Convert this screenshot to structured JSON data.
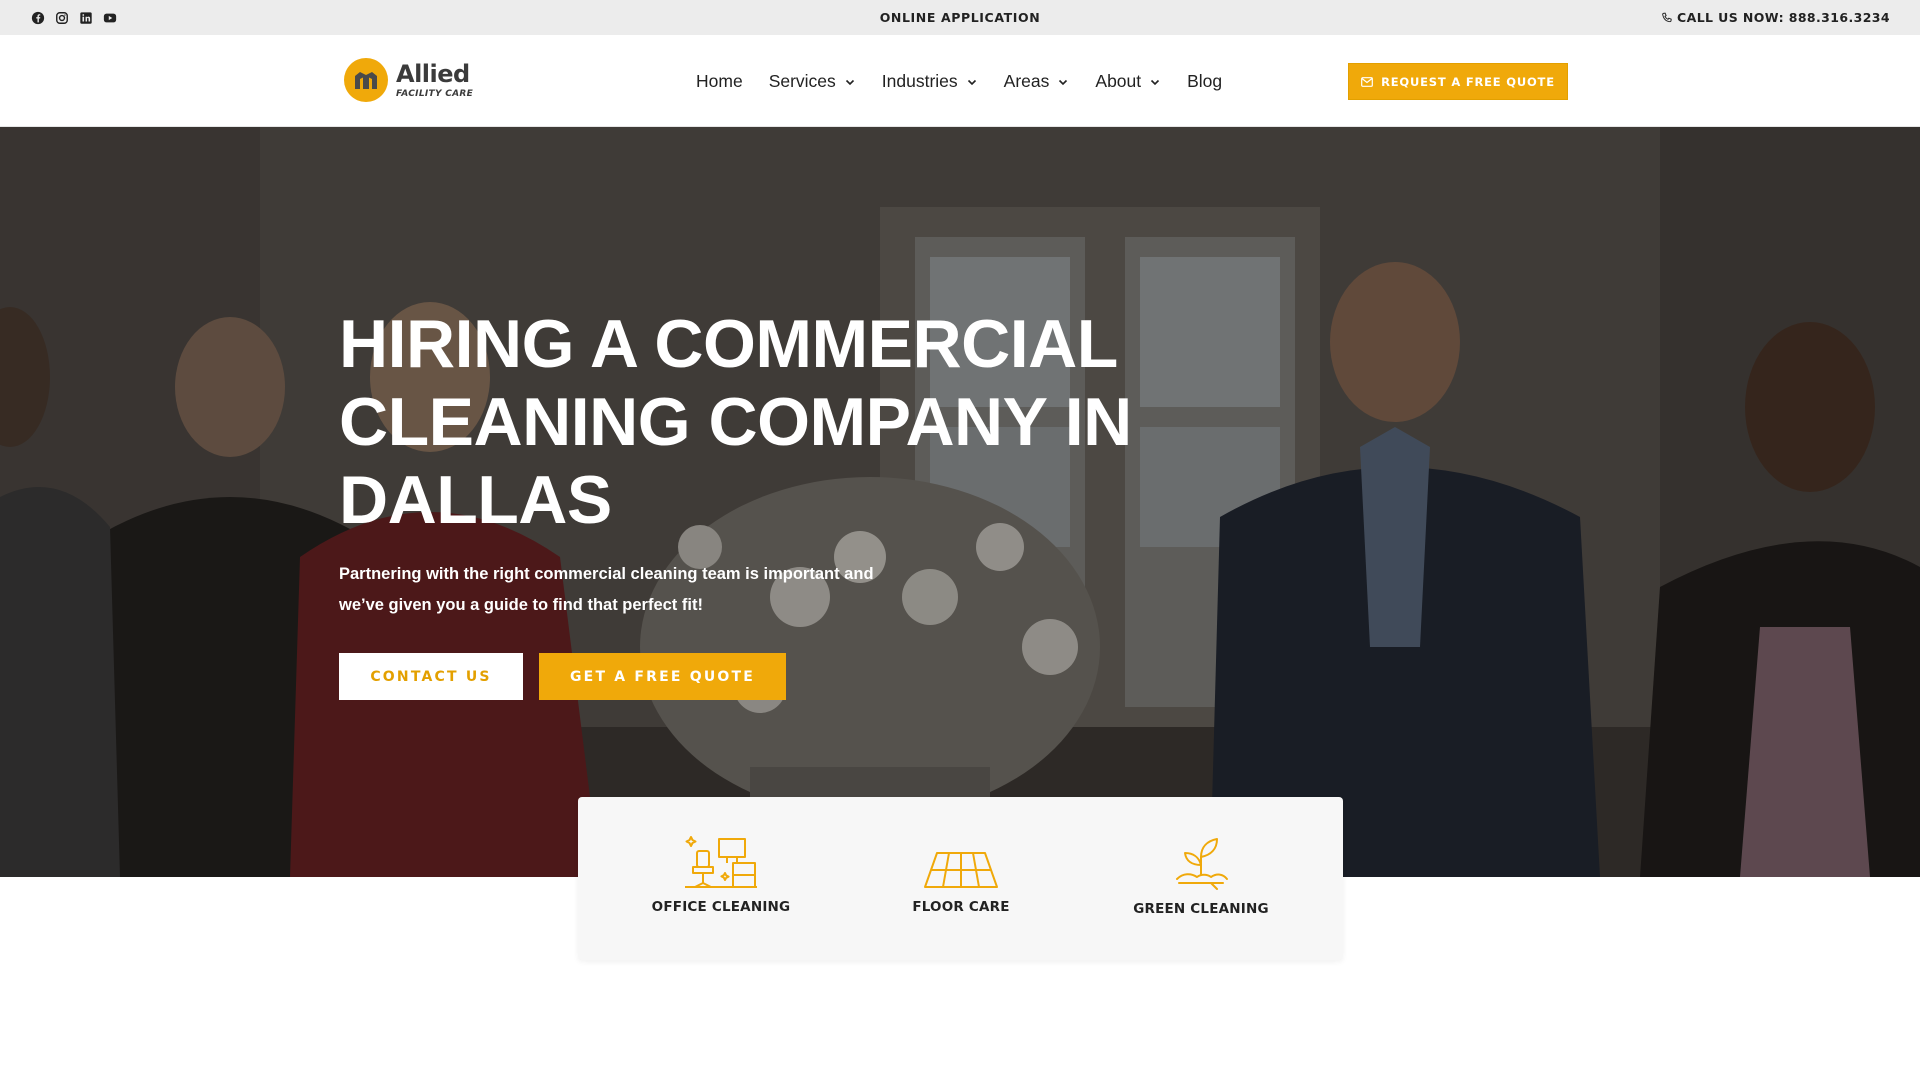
{
  "topbar": {
    "social_icons": [
      "facebook-icon",
      "instagram-icon",
      "linkedin-icon",
      "youtube-icon"
    ],
    "center_link": "ONLINE APPLICATION",
    "phone_text": "CALL US NOW: 888.316.3234"
  },
  "header": {
    "logo_name": "Allied",
    "logo_sub": "FACILITY CARE",
    "nav": [
      {
        "label": "Home",
        "dropdown": false
      },
      {
        "label": "Services",
        "dropdown": true
      },
      {
        "label": "Industries",
        "dropdown": true
      },
      {
        "label": "Areas",
        "dropdown": true
      },
      {
        "label": "About",
        "dropdown": true
      },
      {
        "label": "Blog",
        "dropdown": false
      }
    ],
    "cta_label": "REQUEST A FREE QUOTE"
  },
  "hero": {
    "title_lines": [
      "HIRING A COMMERCIAL",
      "CLEANING COMPANY IN",
      "DALLAS"
    ],
    "subtitle_lines": [
      "Partnering with the right commercial cleaning team is important and",
      "we’ve given you a guide to find that perfect fit!"
    ],
    "contact_label": "CONTACT US",
    "quote_label": "GET A FREE QUOTE"
  },
  "services": [
    {
      "label": "OFFICE CLEANING",
      "icon": "office-desk-icon"
    },
    {
      "label": "FLOOR CARE",
      "icon": "floor-tiles-icon"
    },
    {
      "label": "GREEN CLEANING",
      "icon": "plant-sprout-icon"
    }
  ],
  "colors": {
    "accent": "#f0a90a",
    "topbar_bg": "#ececec",
    "card_bg": "#f7f7f7"
  }
}
